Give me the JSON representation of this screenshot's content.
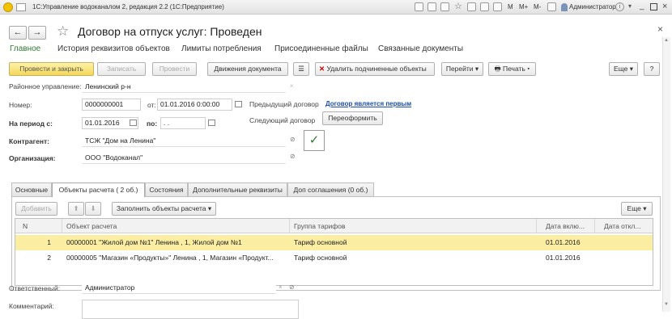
{
  "window": {
    "title": "1С:Управление водоканалом 2, редакция 2.2  (1С:Предприятие)",
    "user": "Администратор",
    "hotkeys": [
      "M",
      "M+",
      "M-"
    ]
  },
  "document": {
    "title": "Договор на отпуск услуг: Проведен"
  },
  "sections": [
    {
      "label": "Главное",
      "active": true
    },
    {
      "label": "История реквизитов объектов"
    },
    {
      "label": "Лимиты потребления"
    },
    {
      "label": "Присоединенные файлы"
    },
    {
      "label": "Связанные документы"
    }
  ],
  "toolbar": {
    "post_close": "Провести и закрыть",
    "write": "Записать",
    "post": "Провести",
    "movements": "Движения документа",
    "delete_sub": "Удалить подчиненные объекты",
    "goto": "Перейти",
    "print": "Печать",
    "more": "Еще",
    "help": "?"
  },
  "form": {
    "district_label": "Районное управление:",
    "district_value": "Ленинский р-н",
    "number_label": "Номер:",
    "number_value": "0000000001",
    "from_label": "от:",
    "date_value": "01.01.2016  0:00:00",
    "period_label": "На период с:",
    "period_from": "01.01.2016",
    "period_to_label": "по:",
    "period_to": ". .",
    "prev_contract_label": "Предыдущий договор",
    "prev_contract_link": "Договор является первым",
    "next_contract_label": "Следующий договор",
    "reissue_button": "Переоформить",
    "counterparty_label": "Контрагент:",
    "counterparty_value": "ТСЖ \"Дом на Ленина\"",
    "org_label": "Организация:",
    "org_value": "ООО \"Водоканал\"",
    "responsible_label": "Ответственный:",
    "responsible_value": "Администратор",
    "comment_label": "Комментарий:"
  },
  "tabs": [
    {
      "label": "Основные"
    },
    {
      "label": "Объекты расчета ( 2 об.)",
      "active": true
    },
    {
      "label": "Состояния"
    },
    {
      "label": "Дополнительные реквизиты"
    },
    {
      "label": "Доп соглашения (0 об.)"
    }
  ],
  "objects_toolbar": {
    "add": "Добавить",
    "fill": "Заполнить объекты расчета",
    "more": "Еще"
  },
  "grid": {
    "columns": [
      "N",
      "Объект расчета",
      "Группа тарифов",
      "Дата вклю...",
      "Дата откл..."
    ],
    "rows": [
      {
        "n": "1",
        "object": "00000001 \"Жилой дом №1\" Ленина , 1, Жилой дом №1",
        "tariff": "Тариф основной",
        "date_on": "01.01.2016",
        "date_off": "",
        "selected": true
      },
      {
        "n": "2",
        "object": "00000005 \"Магазин «Продукты»\" Ленина , 1, Магазин «Продукт...",
        "tariff": "Тариф основной",
        "date_on": "01.01.2016",
        "date_off": ""
      }
    ]
  },
  "colors": {
    "accent_green": "#2e7d32",
    "primary_button": "#f3d75a",
    "selected_row": "#fbeda2",
    "link": "#1a4ea8"
  }
}
